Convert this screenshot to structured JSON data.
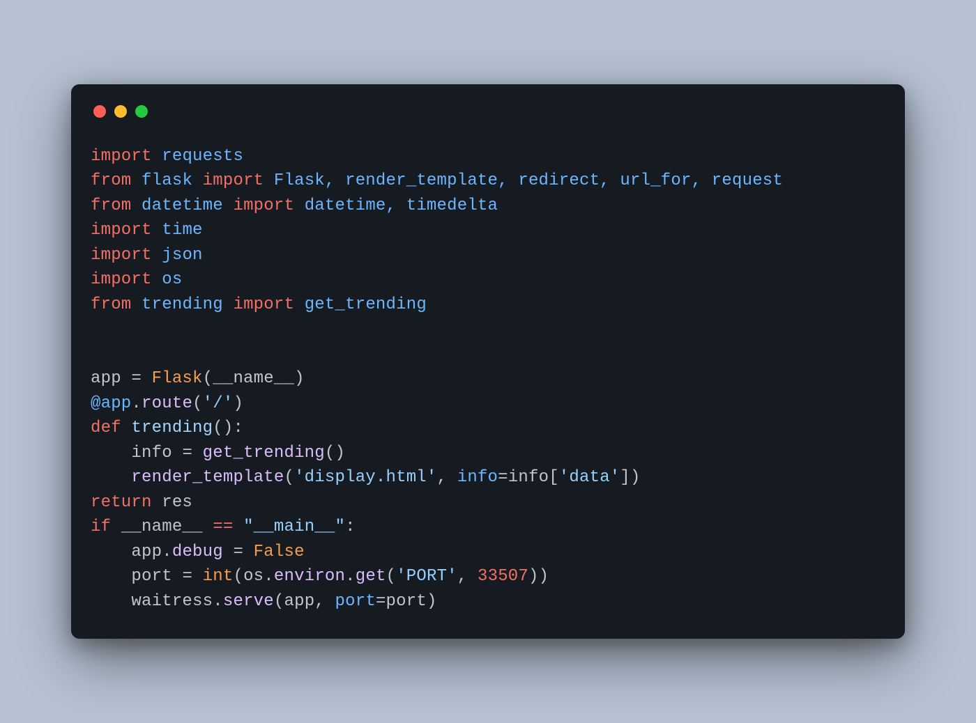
{
  "window": {
    "traffic_lights": {
      "red": "#ff5f56",
      "yellow": "#ffbd2e",
      "green": "#27c93f"
    }
  },
  "code": {
    "line1": {
      "kw1": "import",
      "mod": "requests"
    },
    "line2": {
      "kw1": "from",
      "mod": "flask",
      "kw2": "import",
      "names": "Flask, render_template, redirect, url_for, request"
    },
    "line3": {
      "kw1": "from",
      "mod": "datetime",
      "kw2": "import",
      "names": "datetime, timedelta"
    },
    "line4": {
      "kw1": "import",
      "mod": "time"
    },
    "line5": {
      "kw1": "import",
      "mod": "json"
    },
    "line6": {
      "kw1": "import",
      "mod": "os"
    },
    "line7": {
      "kw1": "from",
      "mod": "trending",
      "kw2": "import",
      "names": "get_trending"
    },
    "line8": {
      "var": "app",
      "eq": " = ",
      "cls": "Flask",
      "open": "(",
      "arg": "__name__",
      "close": ")"
    },
    "line9": {
      "at": "@app",
      "dot": ".",
      "method": "route",
      "open": "(",
      "str": "'/'",
      "close": ")"
    },
    "line10": {
      "kw": "def",
      "name": "trending",
      "parens": "():"
    },
    "line11": {
      "indent": "    ",
      "var": "info",
      "eq": " = ",
      "fn": "get_trending",
      "parens": "()"
    },
    "line12": {
      "indent": "    ",
      "fn": "render_template",
      "open": "(",
      "str1": "'display.html'",
      "comma": ", ",
      "kwarg": "info",
      "eq2": "=",
      "var2": "info",
      "idx_open": "[",
      "str2": "'data'",
      "idx_close": "])"
    },
    "line13": {
      "kw": "return",
      "var": " res"
    },
    "line14": {
      "kw": "if",
      "lhs": " __name__ ",
      "op": "==",
      "rhs": " ",
      "str": "\"__main__\"",
      "colon": ":"
    },
    "line15": {
      "indent": "    ",
      "obj": "app",
      "dot": ".",
      "attr": "debug",
      "eq": " = ",
      "val": "False"
    },
    "line16": {
      "indent": "    ",
      "var": "port",
      "eq": " = ",
      "fn": "int",
      "open": "(",
      "obj": "os",
      "dot1": ".",
      "attr1": "environ",
      "dot2": ".",
      "method": "get",
      "open2": "(",
      "str": "'PORT'",
      "comma": ", ",
      "num": "33507",
      "close": "))"
    },
    "line17": {
      "indent": "    ",
      "obj": "waitress",
      "dot": ".",
      "method": "serve",
      "open": "(",
      "arg1": "app",
      "comma": ", ",
      "kwarg": "port",
      "eq2": "=",
      "arg2": "port",
      "close": ")"
    }
  }
}
